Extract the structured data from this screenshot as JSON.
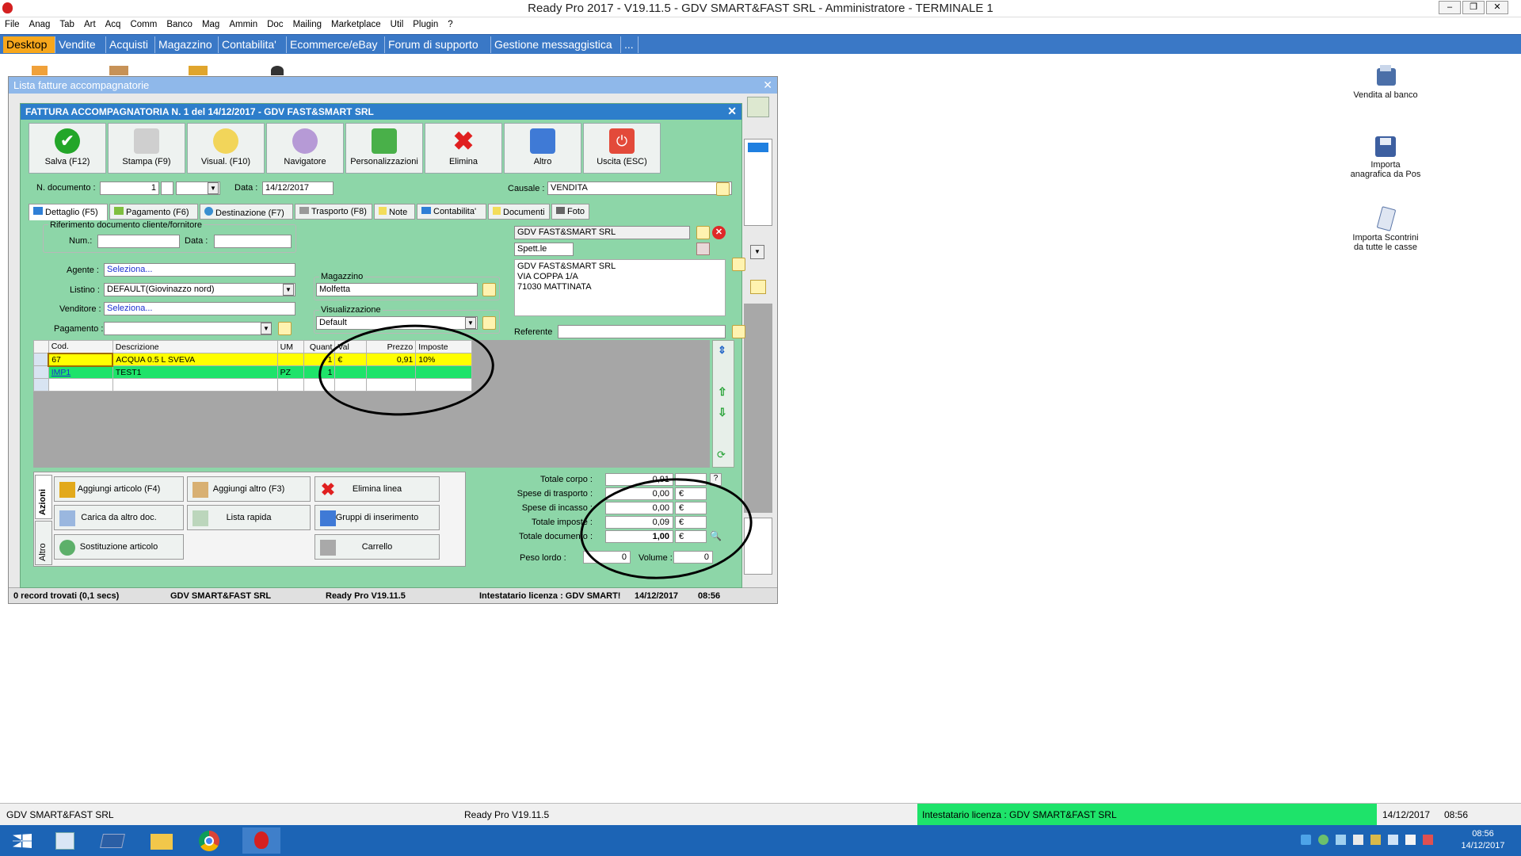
{
  "window": {
    "title": "Ready Pro 2017 - V19.11.5 - GDV SMART&FAST SRL - Amministratore - TERMINALE 1"
  },
  "menu": [
    "File",
    "Anag",
    "Tab",
    "Art",
    "Acq",
    "Comm",
    "Banco",
    "Mag",
    "Ammin",
    "Doc",
    "Mailing",
    "Marketplace",
    "Util",
    "Plugin",
    "?"
  ],
  "main_tabs": [
    "Desktop",
    "Vendite",
    "Acquisti",
    "Magazzino",
    "Contabilita'",
    "Ecommerce/eBay",
    "Forum di supporto",
    "Gestione messaggistica",
    "..."
  ],
  "desktop_icons": [
    "Vendita al banco",
    "Importa anagrafica da Pos",
    "Importa Scontrini da tutte le casse"
  ],
  "bg_window": {
    "title": "Lista fatture accompagnatorie"
  },
  "form": {
    "title": "FATTURA ACCOMPAGNATORIA N. 1 del 14/12/2017 - GDV FAST&SMART SRL",
    "toolbar": [
      "Salva (F12)",
      "Stampa (F9)",
      "Visual. (F10)",
      "Navigatore",
      "Personalizzazioni",
      "Elimina",
      "Altro",
      "Uscita (ESC)"
    ],
    "ndoc_label": "N. documento :",
    "ndoc_value": "1",
    "data_label": "Data :",
    "data_value": "14/12/2017",
    "causale_label": "Causale :",
    "causale_value": "VENDITA",
    "tabs": [
      "Dettaglio (F5)",
      "Pagamento (F6)",
      "Destinazione (F7)",
      "Trasporto (F8)",
      "Note",
      "Contabilita'",
      "Documenti",
      "Foto"
    ],
    "rif_title": "Riferimento documento cliente/fornitore",
    "num_label": "Num.:",
    "rdata_label": "Data :",
    "agente_label": "Agente :",
    "agente_value": "Seleziona...",
    "listino_label": "Listino :",
    "listino_value": "DEFAULT(Giovinazzo nord)",
    "venditore_label": "Venditore :",
    "venditore_value": "Seleziona...",
    "pagamento_label": "Pagamento :",
    "magazzino_title": "Magazzino",
    "magazzino_value": "Molfetta",
    "visual_title": "Visualizzazione",
    "visual_value": "Default",
    "cliente_name": "GDV FAST&SMART SRL",
    "spett": "Spett.le",
    "address": [
      "GDV FAST&SMART SRL",
      "VIA COPPA 1/A",
      "71030 MATTINATA"
    ],
    "referente_label": "Referente",
    "grid_headers": [
      "Cod.",
      "Descrizione",
      "UM",
      "Quant",
      "Val",
      "Prezzo",
      "Imposte"
    ],
    "grid_rows": [
      {
        "cod": "67",
        "descr": "ACQUA 0.5 L SVEVA",
        "um": "",
        "quant": "1",
        "val": "€",
        "prezzo": "0,91",
        "imposte": "10%"
      },
      {
        "cod": "IMP1",
        "descr": "TEST1",
        "um": "PZ",
        "quant": "1",
        "val": "",
        "prezzo": "",
        "imposte": ""
      }
    ],
    "side_tabs": [
      "Azioni",
      "Altro"
    ],
    "actions": [
      "Aggiungi articolo (F4)",
      "Aggiungi altro (F3)",
      "Elimina linea",
      "Carica da altro doc.",
      "Lista rapida",
      "Gruppi di inserimento",
      "Sostituzione articolo",
      "Carrello"
    ],
    "totals": [
      {
        "label": "Totale corpo :",
        "value": "0,91",
        "cur": ""
      },
      {
        "label": "Spese di trasporto :",
        "value": "0,00",
        "cur": "€"
      },
      {
        "label": "Spese di incasso :",
        "value": "0,00",
        "cur": "€"
      },
      {
        "label": "Totale imposte :",
        "value": "0,09",
        "cur": "€"
      },
      {
        "label": "Totale documento :",
        "value": "1,00",
        "cur": "€"
      }
    ],
    "peso_label": "Peso lordo :",
    "peso_value": "0",
    "volume_label": "Volume :",
    "volume_value": "0"
  },
  "bg_status": [
    "0 record trovati (0,1 secs)",
    "GDV SMART&FAST SRL",
    "Ready Pro V19.11.5",
    "Intestatario licenza : GDV SMART!",
    "14/12/2017",
    "08:56"
  ],
  "bottom_status": [
    "GDV SMART&FAST SRL",
    "Ready Pro V19.11.5",
    "Intestatario licenza : GDV SMART&FAST SRL",
    "14/12/2017",
    "08:56"
  ],
  "clock": {
    "time": "08:56",
    "date": "14/12/2017"
  },
  "colors": {
    "form_bg": "#8dd6a8",
    "row1": "#ffff00",
    "row2": "#1ee36a",
    "tabbar": "#3a78c6",
    "active_tab": "#f7a71c",
    "taskbar": "#1c64b5"
  }
}
